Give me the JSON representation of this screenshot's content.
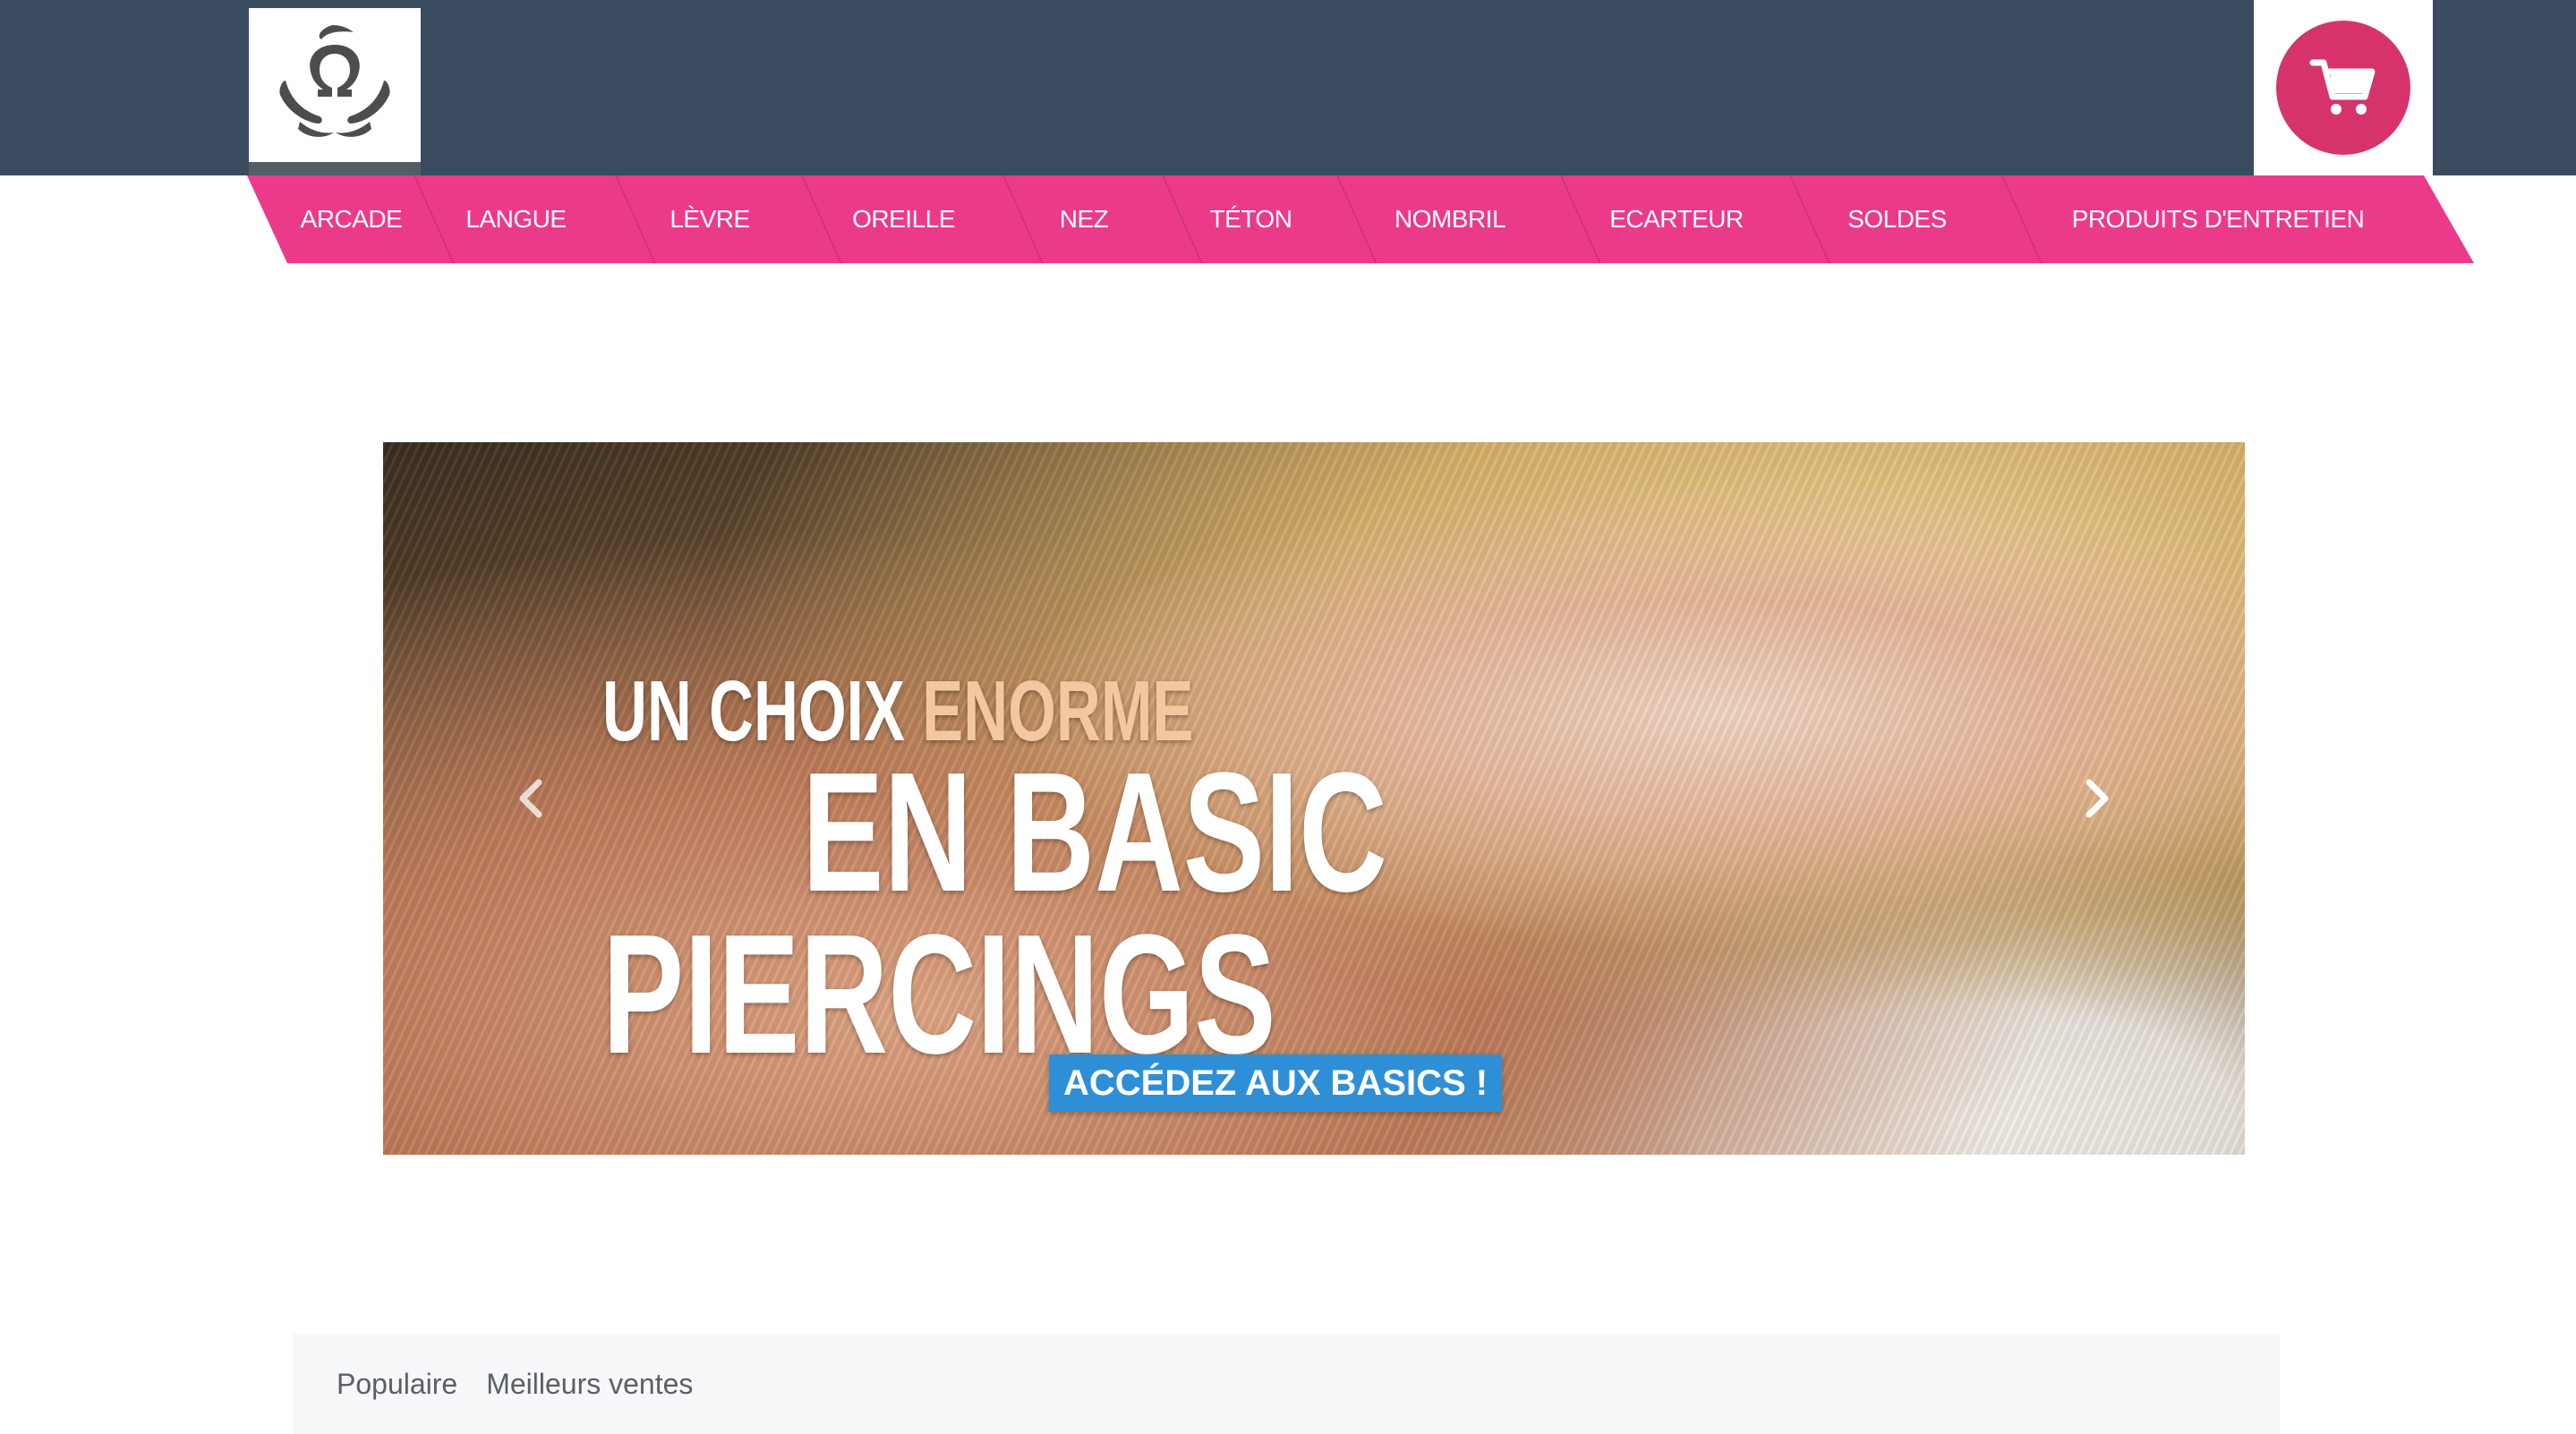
{
  "header": {
    "logo_icon": "omega-hands-logo-icon",
    "cart_icon": "shopping-cart-icon",
    "bar_color": "#3a4b5f",
    "cart_color": "#d6336c"
  },
  "nav": {
    "color": "#ec3a8b",
    "items": [
      {
        "label": "ARCADE"
      },
      {
        "label": "LANGUE"
      },
      {
        "label": "LÈVRE"
      },
      {
        "label": "OREILLE"
      },
      {
        "label": "NEZ"
      },
      {
        "label": "TÉTON"
      },
      {
        "label": "NOMBRIL"
      },
      {
        "label": "ECARTEUR"
      },
      {
        "label": "SOLDES"
      },
      {
        "label": "PRODUITS D'ENTRETIEN"
      }
    ]
  },
  "hero": {
    "line1_a": "UN CHOIX",
    "line1_b": "ENORME",
    "line2": "EN BASIC",
    "line3": "PIERCINGS",
    "cta": "ACCÉDEZ AUX BASICS !",
    "cta_color": "#2f8fd6",
    "prev_icon": "chevron-left-icon",
    "next_icon": "chevron-right-icon"
  },
  "tabs": {
    "items": [
      {
        "label": "Populaire"
      },
      {
        "label": "Meilleurs ventes"
      }
    ]
  }
}
